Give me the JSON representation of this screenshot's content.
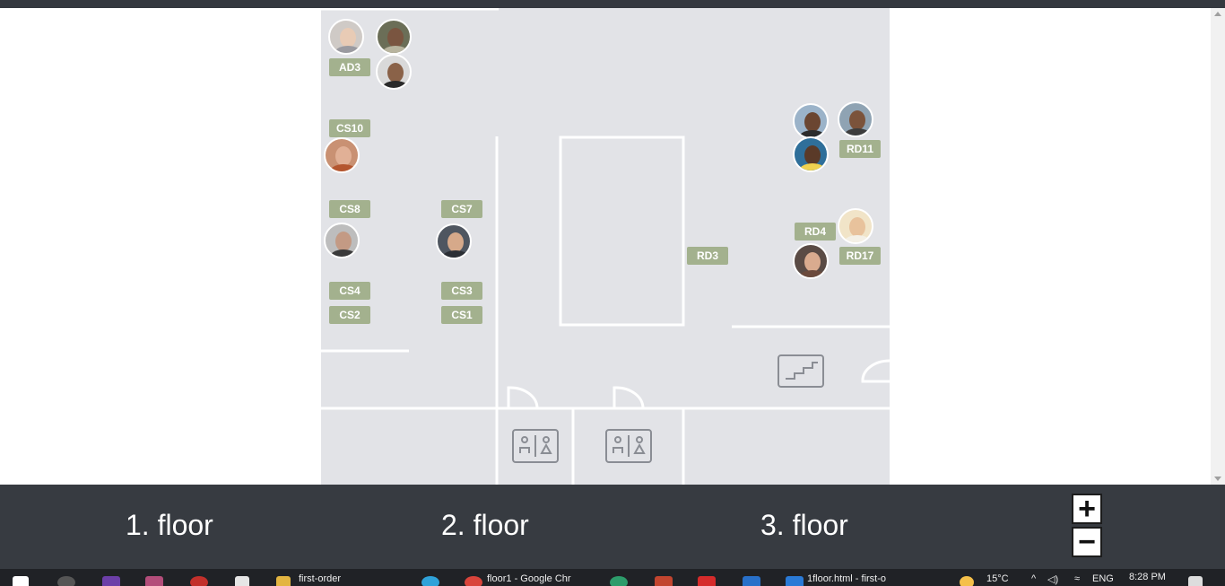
{
  "floors": [
    "1. floor",
    "2. floor",
    "3. floor"
  ],
  "zoom": {
    "in_label": "+",
    "out_label": "−"
  },
  "desks": {
    "ad3": "AD3",
    "cs10": "CS10",
    "cs8": "CS8",
    "cs7": "CS7",
    "cs4": "CS4",
    "cs3": "CS3",
    "cs2": "CS2",
    "cs1": "CS1",
    "rd3": "RD3",
    "rd11": "RD11",
    "rd4": "RD4",
    "rd17": "RD17"
  },
  "taskbar": {
    "items": [
      "first-order",
      "floor1 - Google Chr",
      "1floor.html - first-o"
    ],
    "weather": "15°C",
    "lang": "ENG",
    "time": "8:28 PM"
  },
  "colors": {
    "desk": "#a3b18e",
    "plan_bg": "#e2e3e7",
    "floor_bar": "#373b41"
  }
}
